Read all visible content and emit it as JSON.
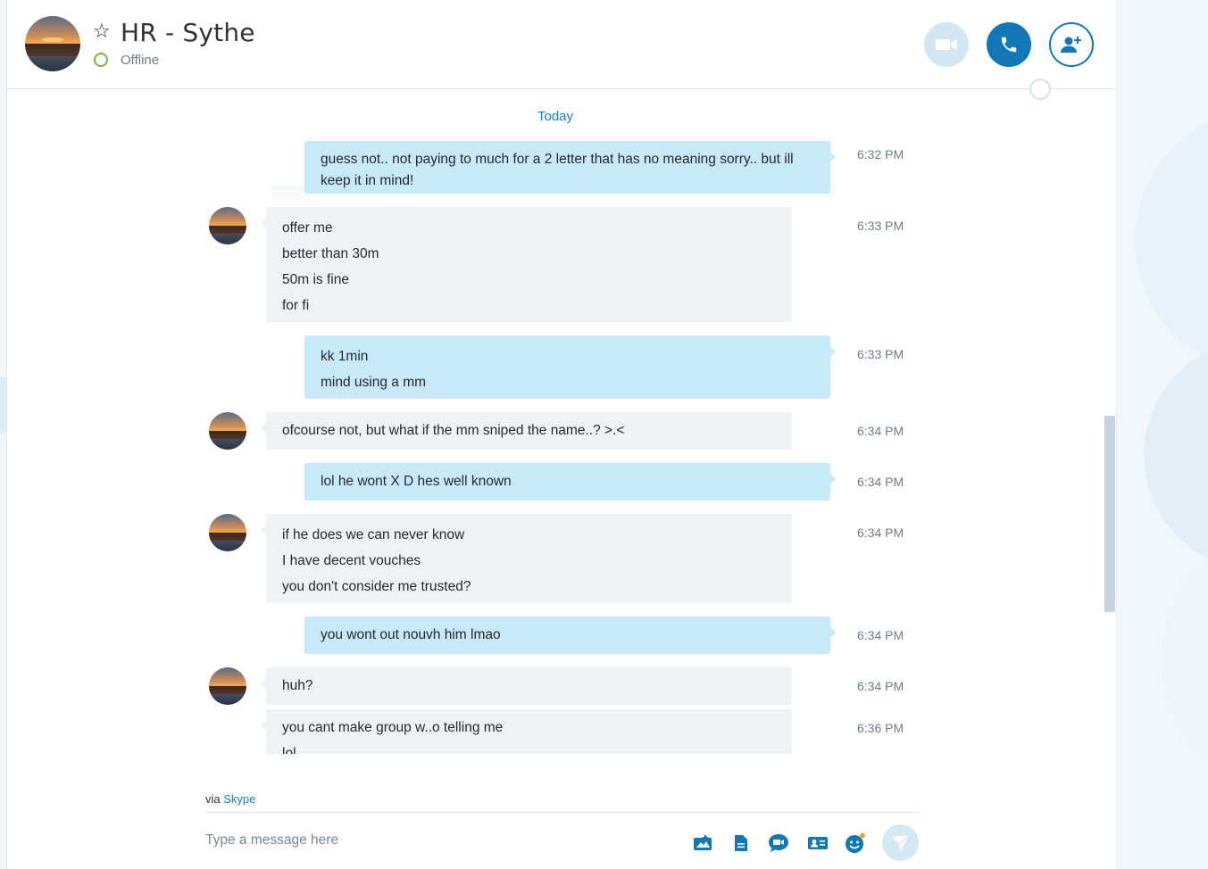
{
  "header": {
    "contact_name": "HR - Sythe",
    "status": "Offline",
    "avatar_icon": "contact-avatar",
    "buttons": {
      "video": "video-call-icon",
      "call": "phone-icon",
      "add": "add-person-icon"
    }
  },
  "conversation": {
    "date_divider": "Today",
    "messages": [
      {
        "dir": "out",
        "lines": [
          "guess not.. not paying to much for a 2 letter that has no meaning sorry.. but ill keep it in mind!"
        ],
        "time": "6:32 PM"
      },
      {
        "dir": "in",
        "lines": [
          "offer me",
          "better than 30m",
          "50m is fine",
          "for fi"
        ],
        "time": "6:33 PM"
      },
      {
        "dir": "out",
        "lines": [
          "kk 1min",
          "mind using a mm"
        ],
        "time": "6:33 PM"
      },
      {
        "dir": "in",
        "lines": [
          "ofcourse not, but what if the mm sniped the name..? >.<"
        ],
        "time": "6:34 PM"
      },
      {
        "dir": "out",
        "lines": [
          "lol he wont X D hes well known"
        ],
        "time": "6:34 PM"
      },
      {
        "dir": "in",
        "lines": [
          "if he does we can never know",
          "I have decent vouches",
          "you don't consider me trusted?"
        ],
        "time": "6:34 PM"
      },
      {
        "dir": "out",
        "lines": [
          "you wont out nouvh him lmao"
        ],
        "time": "6:34 PM"
      },
      {
        "dir": "in",
        "lines": [
          "huh?"
        ],
        "time": "6:34 PM"
      },
      {
        "dir": "in",
        "lines": [
          "you cant make group w..o telling me",
          "lol"
        ],
        "time": "6:36 PM"
      }
    ]
  },
  "composer": {
    "via_prefix": "via",
    "via_link": "Skype",
    "placeholder": "Type a message here",
    "tools": [
      "media-icon",
      "file-icon",
      "video-message-icon",
      "contact-card-icon",
      "emoticon-icon",
      "send-icon"
    ]
  },
  "colors": {
    "accent": "#0f78b5",
    "outgoing_bubble": "#c7e9f9",
    "incoming_bubble": "#eff2f5",
    "status_online_ring": "#7cb342"
  }
}
